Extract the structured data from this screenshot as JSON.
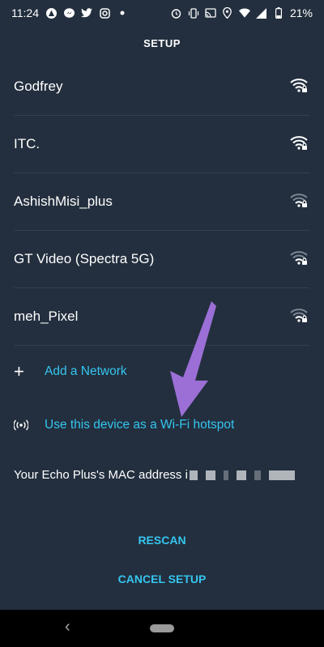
{
  "status": {
    "time": "11:24",
    "battery": "21%",
    "left_icons": [
      "app-icon",
      "messenger-icon",
      "twitter-icon",
      "instagram-icon",
      "dot-icon"
    ],
    "right_icons": [
      "alarm-icon",
      "vibrate-icon",
      "cast-icon",
      "location-icon",
      "wifi-icon",
      "signal-icon",
      "battery-icon"
    ]
  },
  "title": "SETUP",
  "networks": [
    {
      "name": "Godfrey",
      "strength": 1.0
    },
    {
      "name": "ITC.",
      "strength": 1.0
    },
    {
      "name": "AshishMisi_plus",
      "strength": 0.5
    },
    {
      "name": "GT Video (Spectra 5G)",
      "strength": 0.5
    },
    {
      "name": "meh_Pixel",
      "strength": 0.5
    }
  ],
  "add_network": "Add a Network",
  "hotspot": "Use this device as a Wi-Fi hotspot",
  "mac_label": "Your Echo Plus's MAC address i",
  "rescan": "RESCAN",
  "cancel": "CANCEL SETUP",
  "colors": {
    "background": "#232f3e",
    "accent": "#35c5f0",
    "arrow": "#9b6fd6"
  }
}
